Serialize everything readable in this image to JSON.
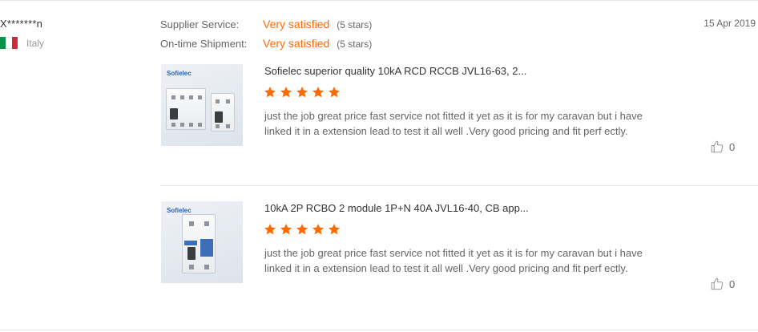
{
  "buyer": {
    "name": "X*******n",
    "country": "Italy"
  },
  "ratings": [
    {
      "label": "Supplier Service:",
      "value": "Very satisfied",
      "stars": "(5 stars)"
    },
    {
      "label": "On-time Shipment:",
      "value": "Very satisfied",
      "stars": "(5 stars)"
    }
  ],
  "date": "15 Apr 2019",
  "reviews": [
    {
      "product_title": "Sofielec superior quality 10kA RCD RCCB JVL16-63, 2...",
      "thumb_brand": "Sofielec",
      "rating": 5,
      "text": "just the job great price fast service not fitted it yet as it is for my caravan but i have linked it in a extension lead to test it all well .Very good pricing and fit perf ectly.",
      "likes": "0"
    },
    {
      "product_title": "10kA 2P RCBO 2 module 1P+N 40A JVL16-40, CB app...",
      "thumb_brand": "Sofielec",
      "rating": 5,
      "text": "just the job great price fast service not fitted it yet as it is for my caravan but i have linked it in a extension lead to test it all well .Very good pricing and fit perf ectly.",
      "likes": "0"
    }
  ],
  "colors": {
    "accent": "#ff6a00",
    "star": "#ff6a00",
    "flag_green": "#009246",
    "flag_red": "#ce2b37"
  },
  "icons": {
    "flag": "italy-flag-icon",
    "star": "star-icon",
    "like": "thumbs-up-icon"
  }
}
